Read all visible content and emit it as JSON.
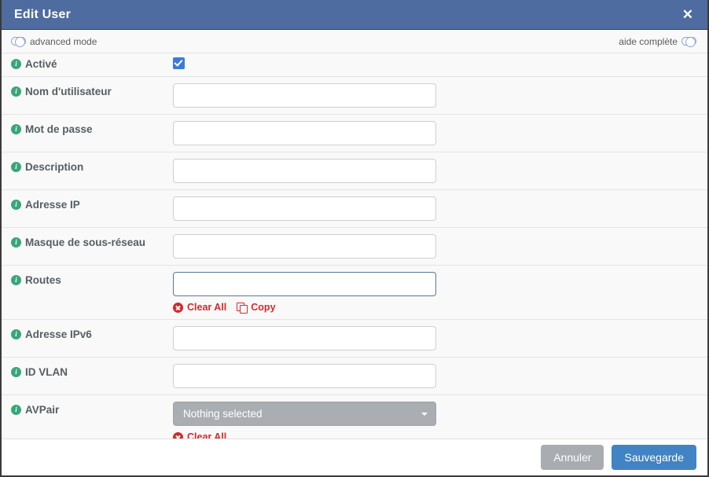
{
  "window": {
    "title": "Edit User",
    "close_label": "✕"
  },
  "toggles": {
    "advanced_mode_label": "advanced mode",
    "full_help_label": "aide complète"
  },
  "form": {
    "rows": [
      {
        "label": "Activé",
        "type": "checkbox",
        "checked": true
      },
      {
        "label": "Nom d'utilisateur",
        "type": "text",
        "value": "",
        "placeholder": ""
      },
      {
        "label": "Mot de passe",
        "type": "text",
        "value": "",
        "placeholder": ""
      },
      {
        "label": "Description",
        "type": "text",
        "value": "",
        "placeholder": ""
      },
      {
        "label": "Adresse IP",
        "type": "text",
        "value": "",
        "placeholder": ""
      },
      {
        "label": "Masque de sous-réseau",
        "type": "text",
        "value": "",
        "placeholder": ""
      },
      {
        "label": "Routes",
        "type": "text-actions",
        "value": "",
        "placeholder": "",
        "focused": true
      },
      {
        "label": "Adresse IPv6",
        "type": "text",
        "value": "",
        "placeholder": ""
      },
      {
        "label": "ID VLAN",
        "type": "text",
        "value": "",
        "placeholder": ""
      },
      {
        "label": "AVPair",
        "type": "select-actions",
        "selected": "Nothing selected"
      }
    ]
  },
  "actions": {
    "clear_all_label": "Clear All",
    "copy_label": "Copy"
  },
  "footer": {
    "cancel_label": "Annuler",
    "save_label": "Sauvegarde"
  },
  "colors": {
    "titlebar": "#4e6ca0",
    "accent_save": "#4283c4",
    "accent_cancel": "#a9adb2",
    "info_icon": "#3aa678",
    "action_red": "#d9282c",
    "checkbox_blue": "#3a7bd8",
    "dropdown_gray": "#aaaeb3"
  }
}
